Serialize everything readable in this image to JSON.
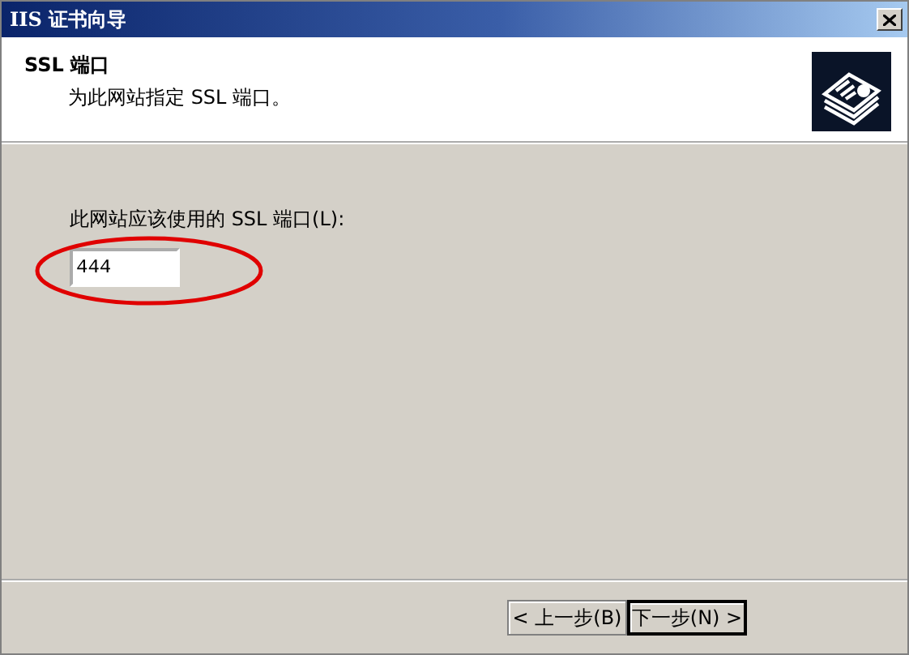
{
  "window": {
    "title": "IIS 证书向导"
  },
  "header": {
    "title": "SSL 端口",
    "subtitle": "为此网站指定 SSL 端口。"
  },
  "port_field": {
    "label": "此网站应该使用的 SSL 端口(L):",
    "value": "444",
    "highlighted": true
  },
  "buttons": [
    {
      "label": "< 上一步(B)",
      "default": false
    },
    {
      "label": "下一步(N) >",
      "default": true
    }
  ]
}
